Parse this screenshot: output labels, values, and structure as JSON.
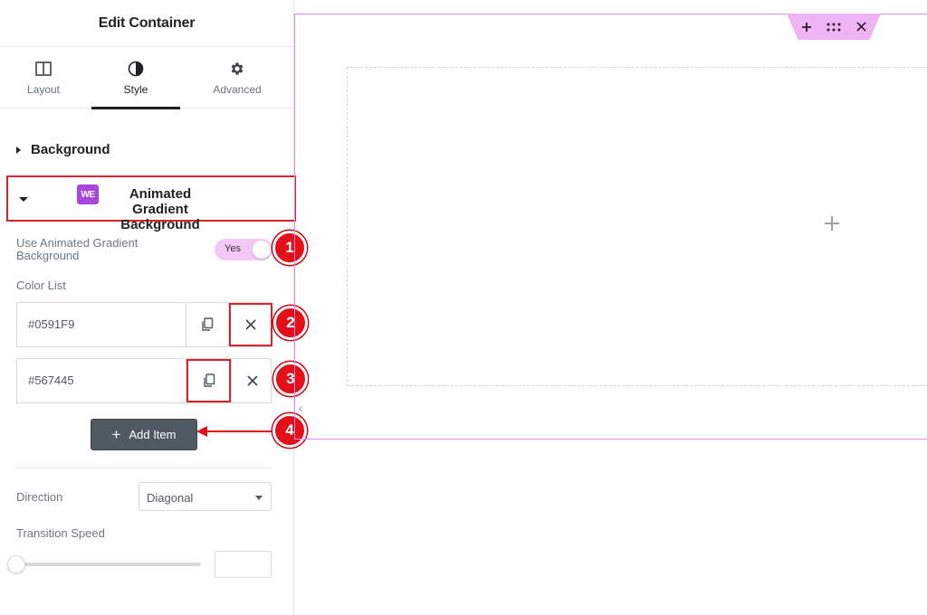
{
  "panel": {
    "title": "Edit Container",
    "tabs": [
      {
        "label": "Layout",
        "icon": "columns-icon"
      },
      {
        "label": "Style",
        "icon": "contrast-icon"
      },
      {
        "label": "Advanced",
        "icon": "gear-icon"
      }
    ],
    "active_tab": "Style"
  },
  "sections": {
    "background_label": "Background",
    "agb": {
      "badge": "WE",
      "title": "Animated Gradient Background"
    }
  },
  "controls": {
    "use_agb_label": "Use Animated Gradient Background",
    "toggle_text": "Yes",
    "color_list_label": "Color List",
    "colors": [
      "#0591F9",
      "#567445"
    ],
    "add_item_label": "Add Item",
    "direction_label": "Direction",
    "direction_value": "Diagonal",
    "transition_label": "Transition Speed",
    "transition_value": "",
    "slider_fraction": 0
  },
  "markers": [
    "1",
    "2",
    "3",
    "4"
  ],
  "colors": {
    "highlight": "#d9232d",
    "marker": "#e40f18",
    "toggle_on": "#f3c8f7",
    "container_outline": "#e38de8",
    "toolbar": "#f0b3f4",
    "button": "#515962"
  }
}
